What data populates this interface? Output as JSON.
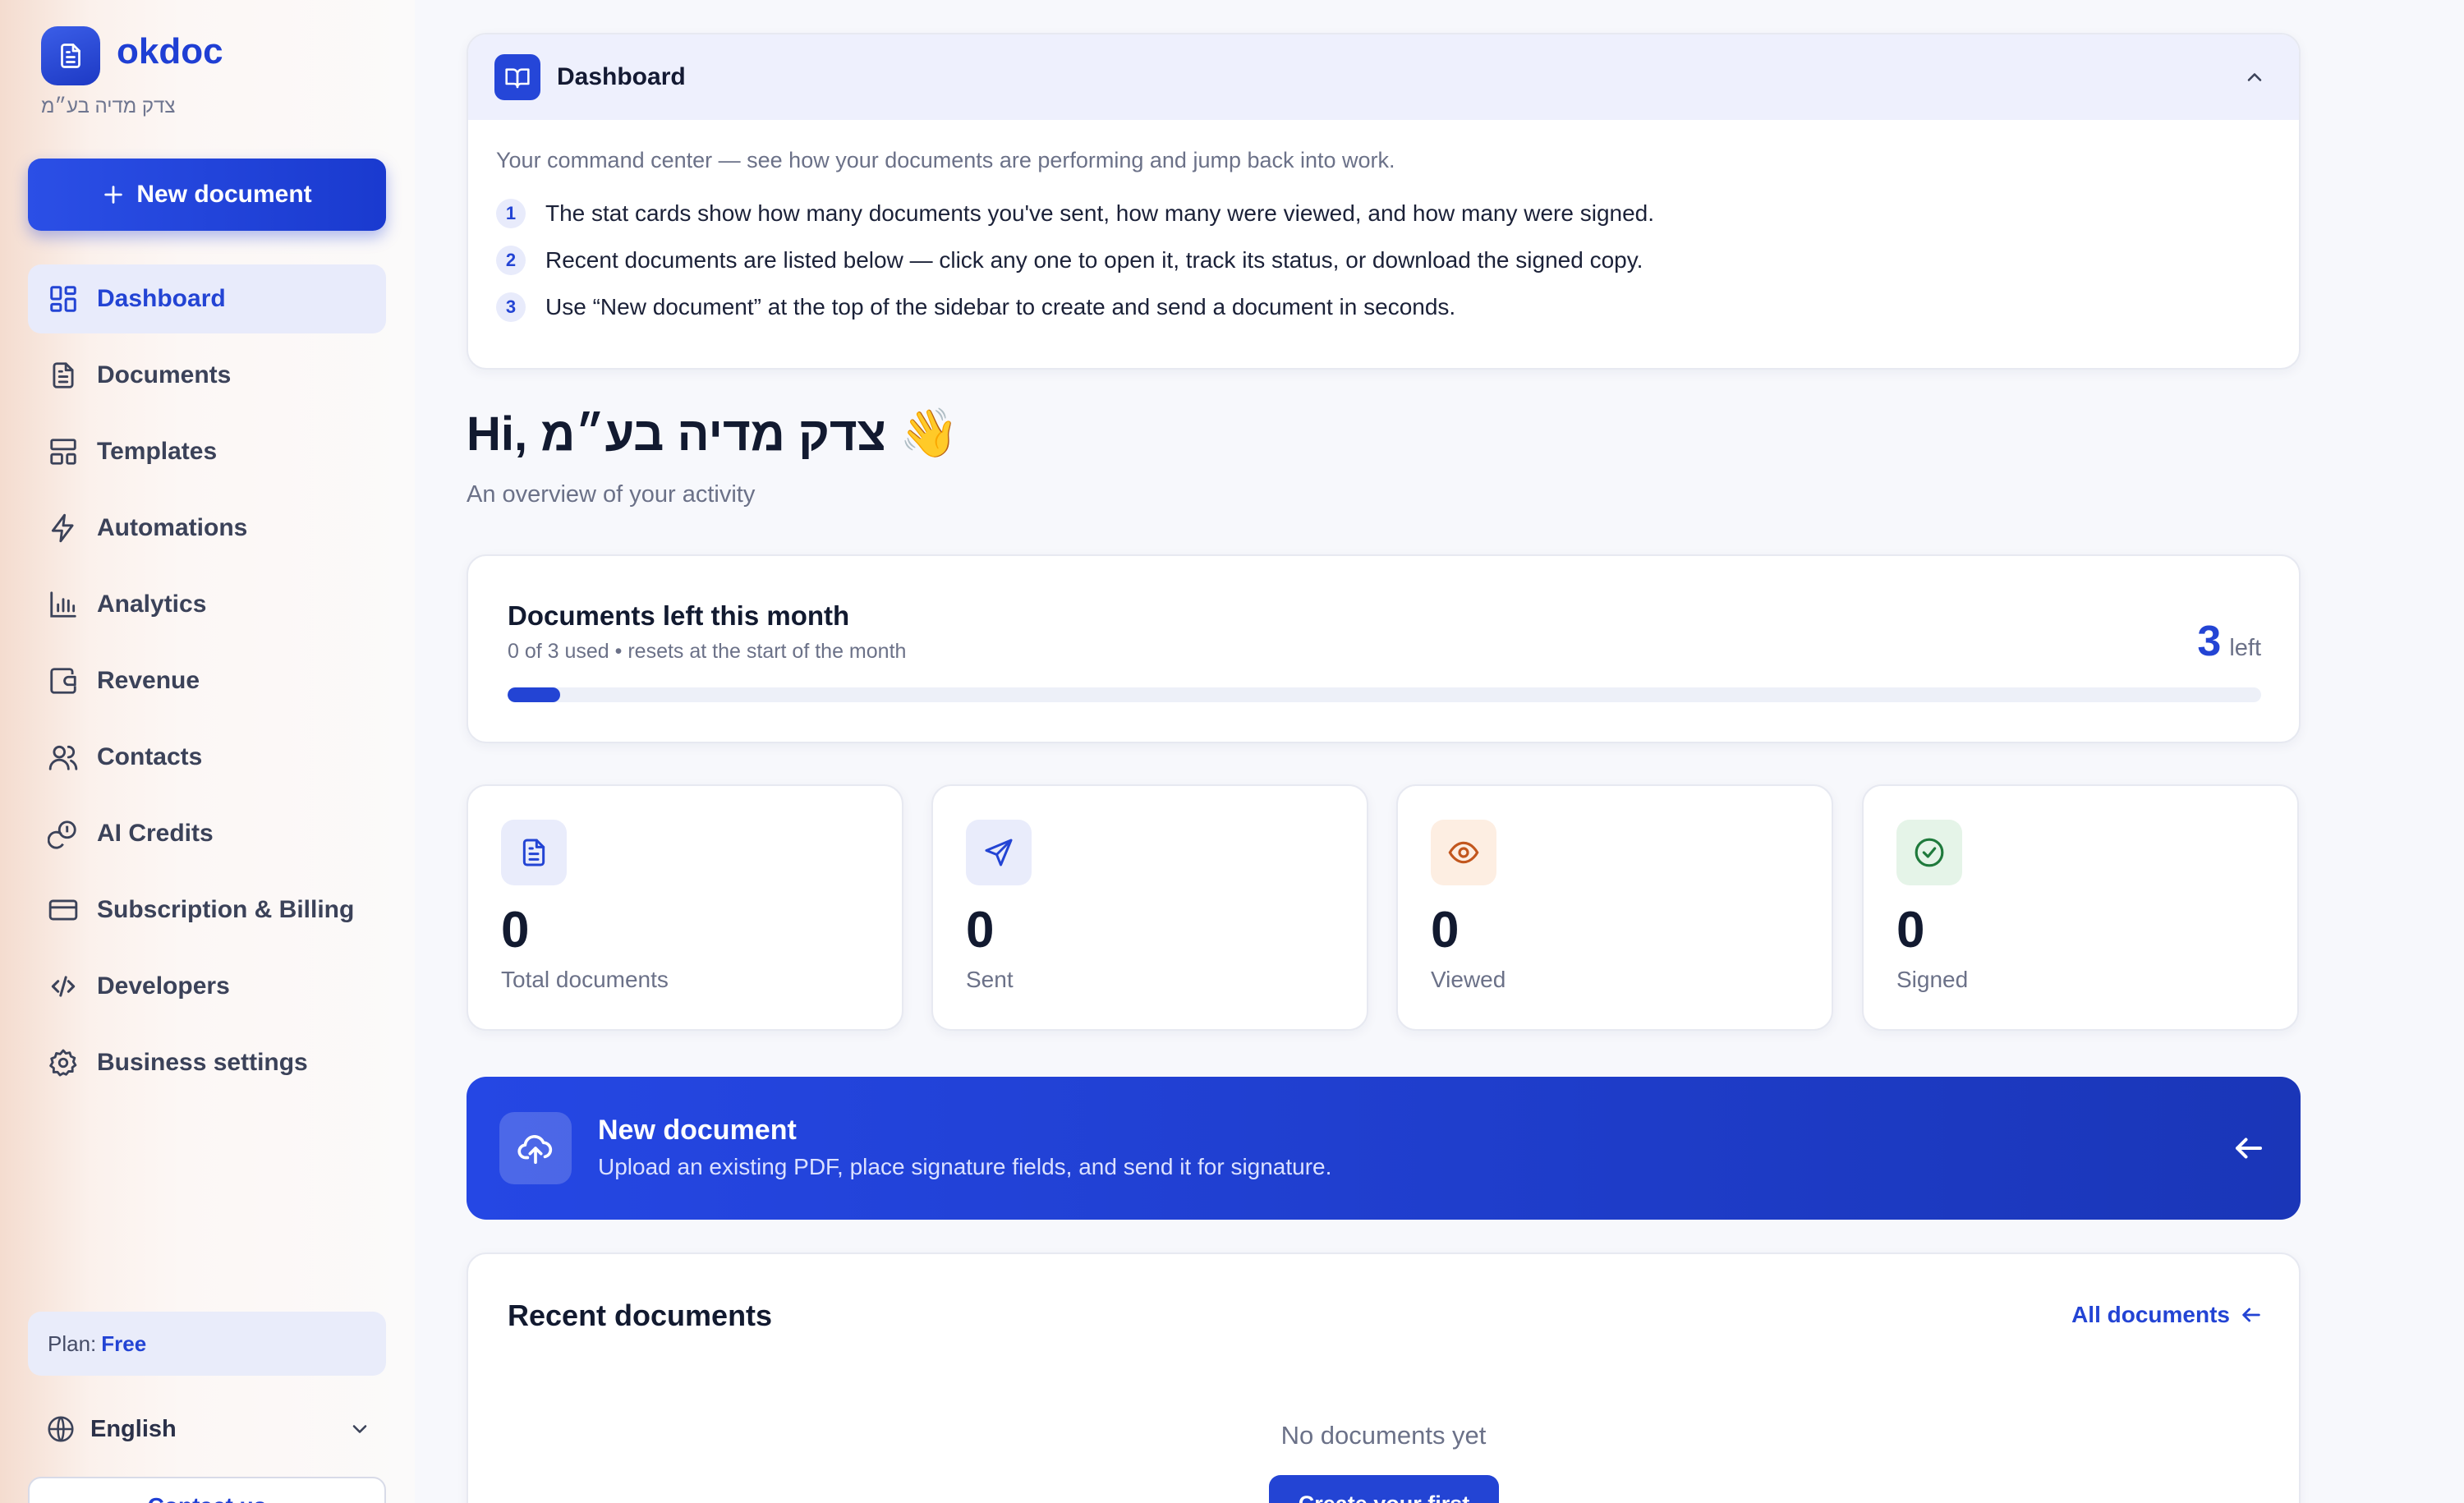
{
  "brand": {
    "name": "okdoc",
    "org": "צדק מדיה בע״מ"
  },
  "sidebar": {
    "new_document": "New document",
    "items": [
      {
        "label": "Dashboard",
        "icon": "dashboard-icon"
      },
      {
        "label": "Documents",
        "icon": "document-icon"
      },
      {
        "label": "Templates",
        "icon": "templates-icon"
      },
      {
        "label": "Automations",
        "icon": "lightning-icon"
      },
      {
        "label": "Analytics",
        "icon": "bar-chart-icon"
      },
      {
        "label": "Revenue",
        "icon": "wallet-icon"
      },
      {
        "label": "Contacts",
        "icon": "users-icon"
      },
      {
        "label": "AI Credits",
        "icon": "coins-icon"
      },
      {
        "label": "Subscription & Billing",
        "icon": "credit-card-icon"
      },
      {
        "label": "Developers",
        "icon": "code-icon"
      },
      {
        "label": "Business settings",
        "icon": "gear-icon"
      }
    ],
    "plan_label": "Plan:",
    "plan_value": "Free",
    "language": "English",
    "bottom_button": "Contact us"
  },
  "help": {
    "title": "Dashboard",
    "intro": "Your command center — see how your documents are performing and jump back into work.",
    "steps": [
      {
        "n": "1",
        "text": "The stat cards show how many documents you've sent, how many were viewed, and how many were signed."
      },
      {
        "n": "2",
        "text": "Recent documents are listed below — click any one to open it, track its status, or download the signed copy."
      },
      {
        "n": "3",
        "text": "Use “New document” at the top of the sidebar to create and send a document in seconds."
      }
    ]
  },
  "greeting": {
    "text": "Hi, צדק מדיה בע״מ",
    "emoji": "👋",
    "subtitle": "An overview of your activity"
  },
  "quota": {
    "title": "Documents left this month",
    "subtitle": "0 of 3 used • resets at the start of the month",
    "left_count": "3",
    "left_label": "left",
    "used_fraction": 0.03
  },
  "stats": [
    {
      "value": "0",
      "label": "Total documents",
      "icon": "document-icon",
      "color": "#2344d4",
      "bg": "#e9ecfb"
    },
    {
      "value": "0",
      "label": "Sent",
      "icon": "send-icon",
      "color": "#2344d4",
      "bg": "#e9ecfb"
    },
    {
      "value": "0",
      "label": "Viewed",
      "icon": "eye-icon",
      "color": "#c2561d",
      "bg": "#fdeee2"
    },
    {
      "value": "0",
      "label": "Signed",
      "icon": "check-circle-icon",
      "color": "#1f7a3c",
      "bg": "#e5f4e8"
    }
  ],
  "banner": {
    "title": "New document",
    "subtitle": "Upload an existing PDF, place signature fields, and send it for signature."
  },
  "recent": {
    "title": "Recent documents",
    "all_link": "All documents",
    "empty": "No documents yet",
    "create_button": "Create your first"
  },
  "colors": {
    "accent": "#2344d4",
    "sidebar_bg": "#fcf7f5",
    "page_bg": "#f7f8fc"
  }
}
